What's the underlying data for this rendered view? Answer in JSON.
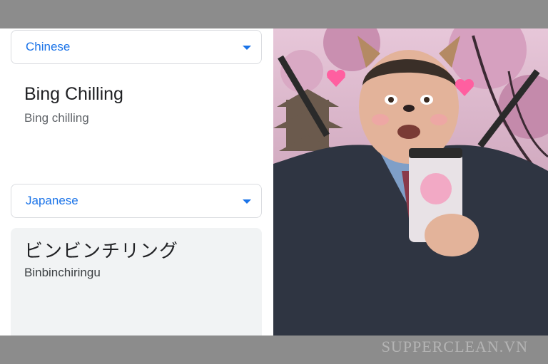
{
  "source": {
    "language": "Chinese",
    "text": "Bing Chilling",
    "transliteration": "Bing chilling"
  },
  "target": {
    "language": "Japanese",
    "text": "ビンビンチリング",
    "transliteration": "Binbinchiringu"
  },
  "photo": {
    "icon": "meme-photo-man-with-cat-filter"
  },
  "watermark": "SUPPERCLEAN.VN",
  "colors": {
    "accent": "#1a73e8",
    "result_bg": "#f1f3f4"
  }
}
